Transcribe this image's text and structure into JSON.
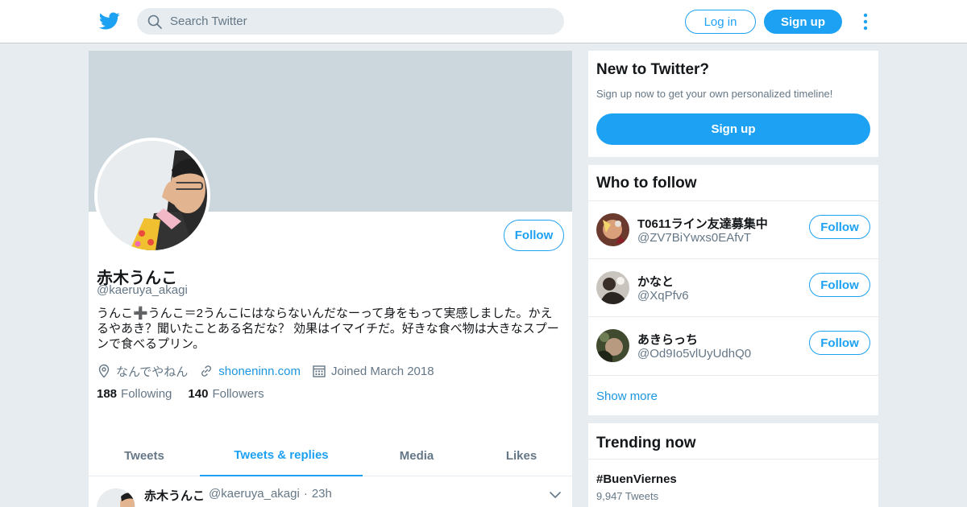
{
  "colors": {
    "accent": "#1da1f2",
    "link": "#1b95e0",
    "secondary_text": "#657786",
    "banner": "#ccd6dd",
    "page_bg": "#e6ecf0"
  },
  "topbar": {
    "logo_icon": "twitter-bird-icon",
    "search_placeholder": "Search Twitter",
    "login_label": "Log in",
    "signup_label": "Sign up",
    "more_icon": "vertical-dots-icon"
  },
  "profile": {
    "name": "赤木うんこ",
    "handle": "@kaeruya_akagi",
    "follow_label": "Follow",
    "bio": "うんこ➕うんこ＝2うんこにはならないんだなーって身をもって実感しました。かえるやあき？聞いたことある名だな？ 効果はイマイチだ。好きな食べ物は大きなスプーンで食べるプリン。",
    "location": "なんでやねん",
    "website": "shoneninn.com",
    "joined": "Joined March 2018",
    "following_count": "188",
    "following_label": "Following",
    "followers_count": "140",
    "followers_label": "Followers"
  },
  "tabs": [
    {
      "label": "Tweets",
      "active": false
    },
    {
      "label": "Tweets & replies",
      "active": true
    },
    {
      "label": "Media",
      "active": false
    },
    {
      "label": "Likes",
      "active": false
    }
  ],
  "tweet": {
    "name": "赤木うんこ",
    "handle": "@kaeruya_akagi",
    "separator": "·",
    "time": "23h"
  },
  "new_to_twitter": {
    "title": "New to Twitter?",
    "subtitle": "Sign up now to get your own personalized timeline!",
    "signup_label": "Sign up"
  },
  "who_to_follow": {
    "title": "Who to follow",
    "items": [
      {
        "name": "T0611ライン友達募集中",
        "handle": "@ZV7BiYwxs0EAfvT",
        "follow_label": "Follow"
      },
      {
        "name": "かなと",
        "handle": "@XqPfv6",
        "follow_label": "Follow"
      },
      {
        "name": "あきらっち",
        "handle": "@Od9Io5vlUyUdhQ0",
        "follow_label": "Follow"
      }
    ],
    "show_more": "Show more"
  },
  "trending": {
    "title": "Trending now",
    "items": [
      {
        "tag": "#BuenViernes",
        "count": "9,947 Tweets"
      }
    ]
  }
}
